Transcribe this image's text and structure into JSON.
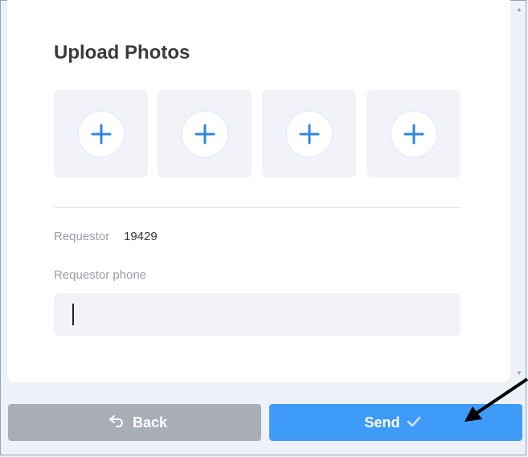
{
  "upload": {
    "title": "Upload Photos",
    "slots": [
      "add-photo-1",
      "add-photo-2",
      "add-photo-3",
      "add-photo-4"
    ]
  },
  "requestor": {
    "label": "Requestor",
    "value": "19429"
  },
  "phone": {
    "label": "Requestor phone",
    "value": "",
    "placeholder": ""
  },
  "buttons": {
    "back_label": "Back",
    "back_icon": "undo-arrow-icon",
    "send_label": "Send",
    "send_icon": "checkmark-icon"
  },
  "colors": {
    "send": "#3e9bf8",
    "back": "#a9adb8",
    "plus": "#2f86e0"
  }
}
